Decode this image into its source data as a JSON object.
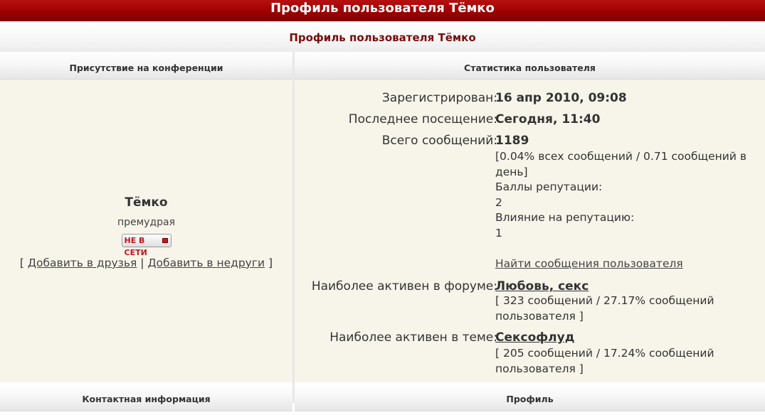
{
  "page": {
    "title": "Профиль пользователя Тёмко",
    "subtitle": "Профиль пользователя Тёмко"
  },
  "columns": {
    "left_header": "Присутствие на конференции",
    "right_header": "Статистика пользователя",
    "bottom_left_header": "Контактная информация",
    "bottom_right_header": "Профиль"
  },
  "user": {
    "name": "Тёмко",
    "rank": "премудрая",
    "status_badge": "НЕ В СЕТИ",
    "add_friend": "Добавить в друзья",
    "add_foe": "Добавить в недруги"
  },
  "stats": {
    "registered_label": "Зарегистрирован:",
    "registered_value": "16 апр 2010, 09:08",
    "last_visit_label": "Последнее посещение:",
    "last_visit_value": "Сегодня, 11:40",
    "total_posts_label": "Всего сообщений:",
    "total_posts_value": "1189",
    "posts_detail_1": "[0.04% всех сообщений / 0.71 сообщений в",
    "posts_detail_2": "день]",
    "rep_points_label": "Баллы репутации:",
    "rep_points_value": "2",
    "rep_influence_label": "Влияние на репутацию:",
    "rep_influence_value": "1",
    "find_posts_link": "Найти сообщения пользователя",
    "active_forum_label": "Наиболее активен в форуме:",
    "active_forum_value": "Любовь, секс",
    "active_forum_detail_1": "[ 323 сообщений / 27.17% сообщений",
    "active_forum_detail_2": "пользователя ]",
    "active_topic_label": "Наиболее активен в теме:",
    "active_topic_value": "Сексофлуд ",
    "active_topic_detail_1": "[ 205 сообщений / 17.24% сообщений",
    "active_topic_detail_2": "пользователя ]"
  },
  "colors": {
    "title_bar": "#9e0000",
    "subtitle_text": "#7a0b0b",
    "panel_bg": "#f7f4ea",
    "offline_red": "#c4151c"
  }
}
